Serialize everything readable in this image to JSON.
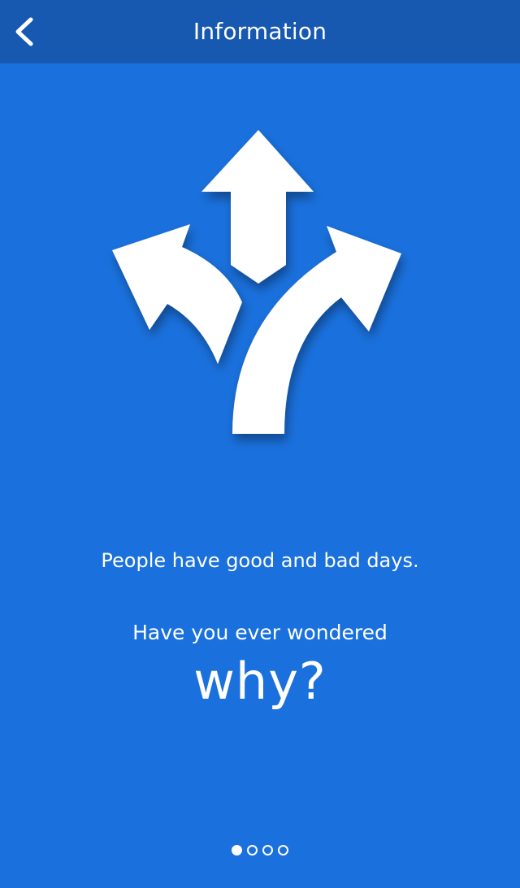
{
  "header": {
    "title": "Information",
    "back_icon": "chevron-left-icon"
  },
  "illustration": {
    "icon": "three-way-arrows-icon"
  },
  "content": {
    "line1": "People have good and bad days.",
    "line2": "Have you ever wondered",
    "emphasis": "why?"
  },
  "pager": {
    "total": 4,
    "current": 1
  },
  "colors": {
    "background": "#1a70dc",
    "header_bar": "#1758b0",
    "foreground": "#ffffff"
  }
}
